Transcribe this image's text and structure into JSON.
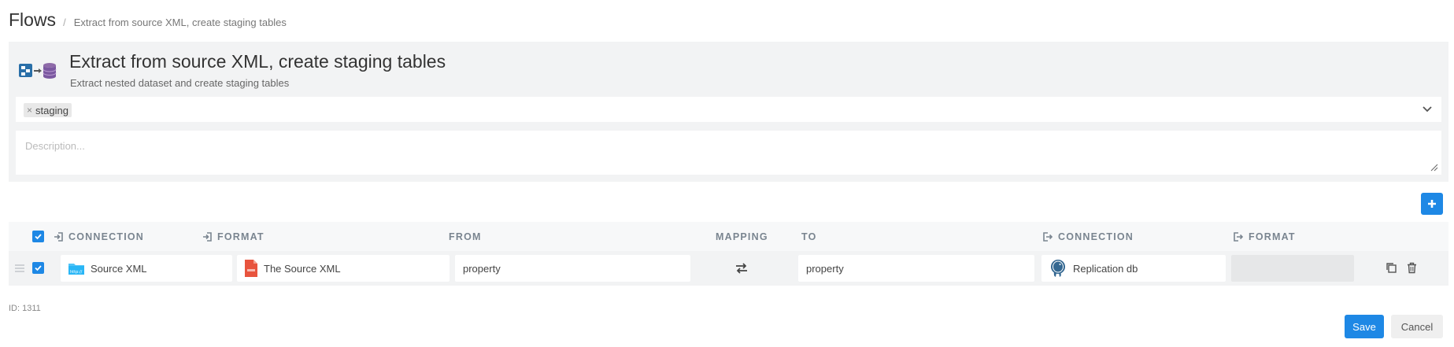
{
  "breadcrumb": {
    "root": "Flows",
    "separator": "/",
    "current": "Extract from source XML, create staging tables"
  },
  "flow": {
    "title": "Extract from source XML, create staging tables",
    "subtitle": "Extract nested dataset and create staging tables",
    "icon": "flow-extract-to-db-icon"
  },
  "tags": {
    "items": [
      {
        "remove": "×",
        "label": "staging"
      }
    ]
  },
  "description": {
    "placeholder": "Description...",
    "value": ""
  },
  "table": {
    "headers": {
      "source_connection": "CONNECTION",
      "source_format": "FORMAT",
      "from": "FROM",
      "mapping": "MAPPING",
      "to": "TO",
      "dest_connection": "CONNECTION",
      "dest_format": "FORMAT"
    },
    "rows": [
      {
        "checked": true,
        "source_connection": "Source XML",
        "source_connection_icon": "http-folder-icon",
        "source_format": "The Source XML",
        "source_format_icon": "xml-file-icon",
        "from": "property",
        "mapping_icon": "swap-arrows-icon",
        "to": "property",
        "dest_connection": "Replication db",
        "dest_connection_icon": "postgresql-elephant-icon",
        "dest_format": ""
      }
    ]
  },
  "footer": {
    "id_label": "ID: 1311",
    "save": "Save",
    "cancel": "Cancel"
  },
  "colors": {
    "accent": "#1e88e5",
    "panel_bg": "#f2f3f4",
    "xml_icon": "#e8543e",
    "folder_icon": "#4fc3f7"
  }
}
